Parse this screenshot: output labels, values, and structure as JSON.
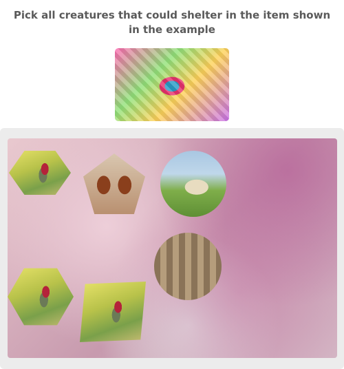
{
  "prompt": {
    "text": "Pick all creatures that could shelter in the item shown in the example"
  },
  "example": {
    "icon": "patterned-shell-icon"
  },
  "tiles": [
    {
      "name": "hummingbird-tile-1",
      "icon": "hummingbird-icon"
    },
    {
      "name": "puppies-tile",
      "icon": "puppies-icon"
    },
    {
      "name": "cow-tile",
      "icon": "cow-icon"
    },
    {
      "name": "kittens-tile",
      "icon": "kittens-icon"
    },
    {
      "name": "hummingbird-tile-2",
      "icon": "hummingbird-icon"
    },
    {
      "name": "hummingbird-tile-3",
      "icon": "hummingbird-icon"
    }
  ],
  "colors": {
    "prompt_text": "#5a5a5a",
    "panel_bg": "#ececec"
  }
}
